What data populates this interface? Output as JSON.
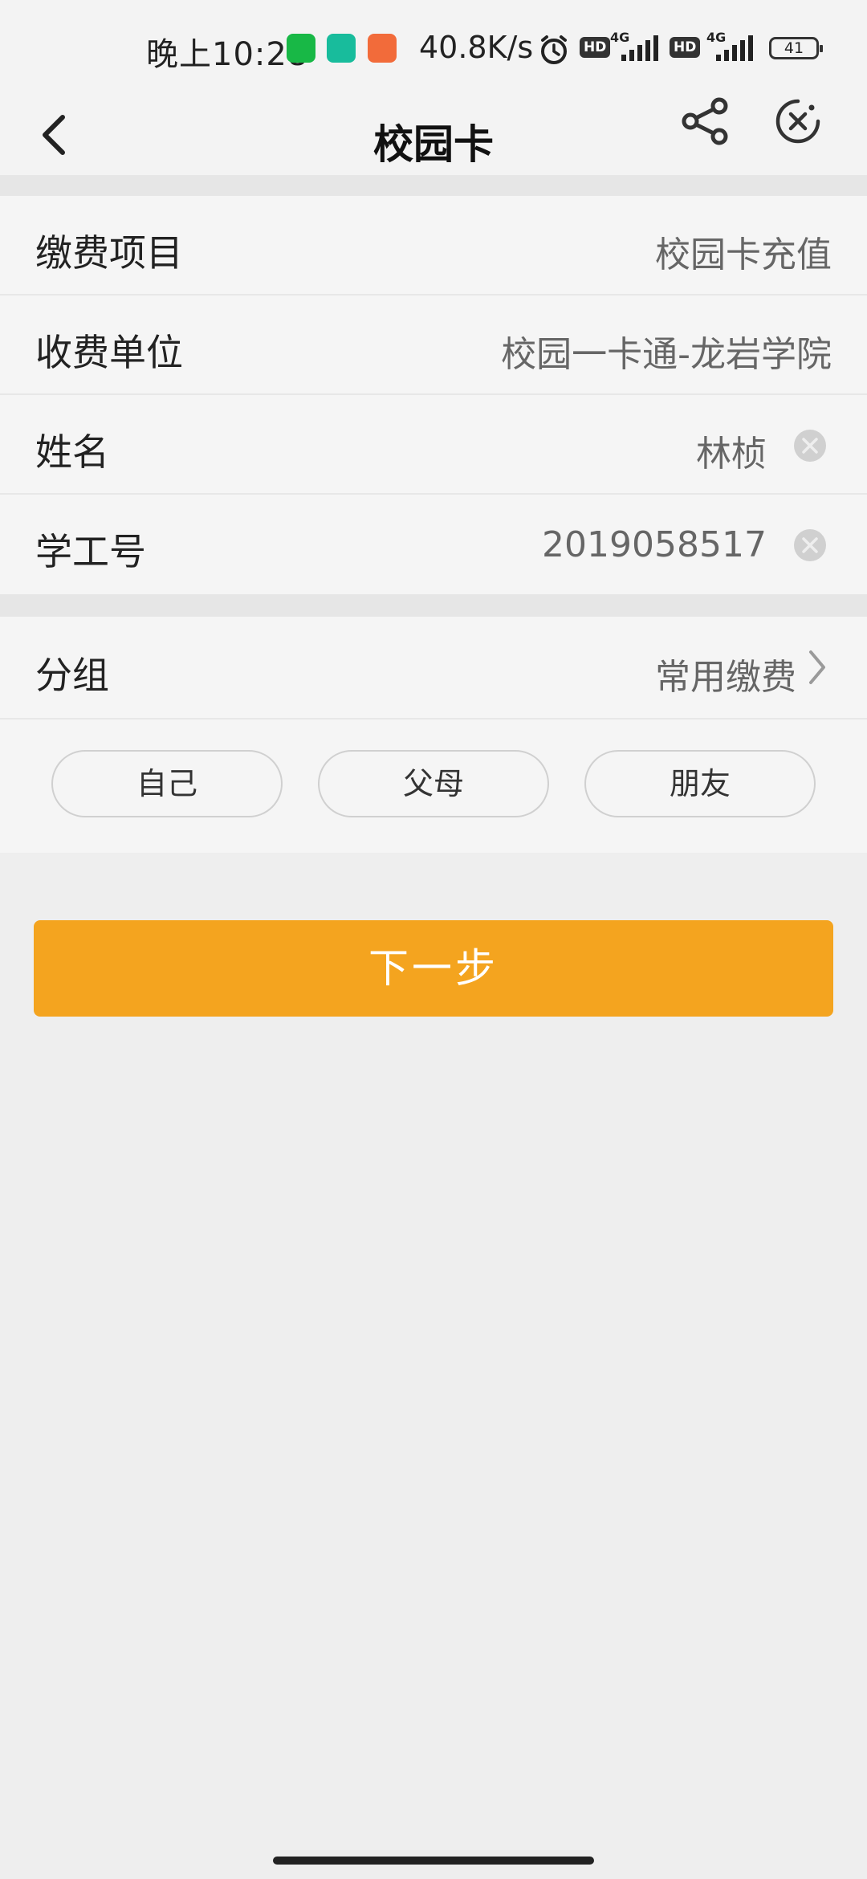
{
  "status_bar": {
    "time": "晚上10:28",
    "speed": "40.8K/s",
    "hd1": "HD",
    "hd2": "HD",
    "net1": "4G",
    "net2": "4G",
    "battery": "41"
  },
  "nav": {
    "title": "校园卡"
  },
  "form": {
    "fee_item_label": "缴费项目",
    "fee_item_value": "校园卡充值",
    "payee_label": "收费单位",
    "payee_value": "校园一卡通-龙岩学院",
    "name_label": "姓名",
    "name_value": "林桢",
    "student_id_label": "学工号",
    "student_id_value": "2019058517"
  },
  "group": {
    "label": "分组",
    "value": "常用缴费",
    "chips": [
      "自己",
      "父母",
      "朋友"
    ]
  },
  "actions": {
    "next_label": "下一步"
  },
  "colors": {
    "accent": "#f4a41f"
  }
}
